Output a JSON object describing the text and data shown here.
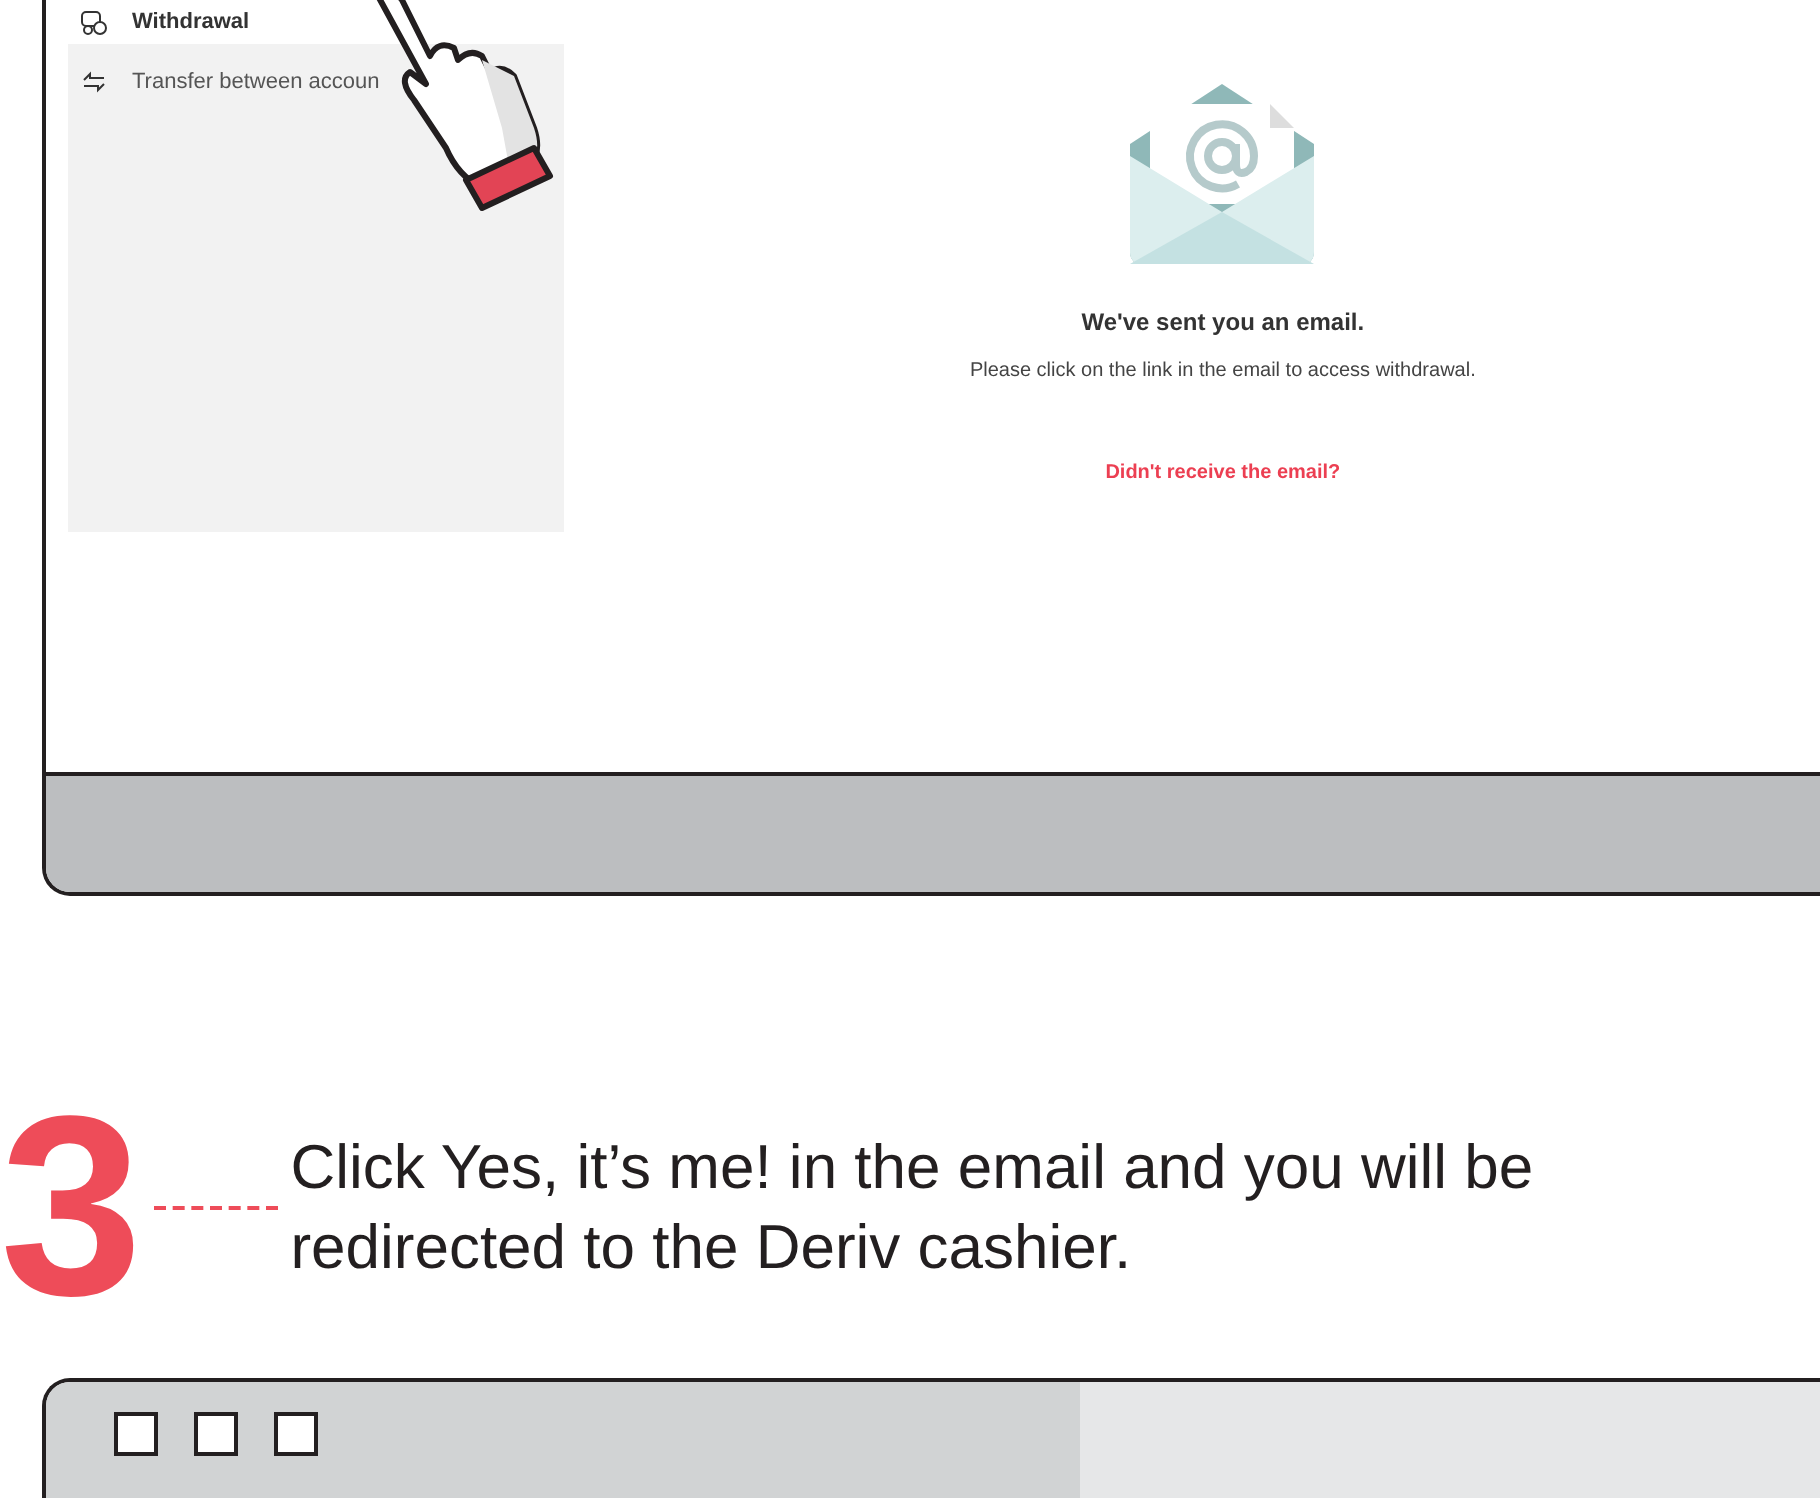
{
  "top_screen": {
    "menu": [
      {
        "kind": "withdrawal",
        "label": "Withdrawal",
        "selected": true
      },
      {
        "kind": "transfer",
        "label": "Transfer between accoun",
        "selected": false
      }
    ],
    "message": {
      "title": "We've sent you an email.",
      "body": "Please click on the link in the email to access withdrawal.",
      "link": "Didn't receive the email?"
    }
  },
  "step": {
    "number": "3",
    "instruction": "Click Yes, it’s me! in the email and you will be redirected to the Deriv cashier."
  }
}
